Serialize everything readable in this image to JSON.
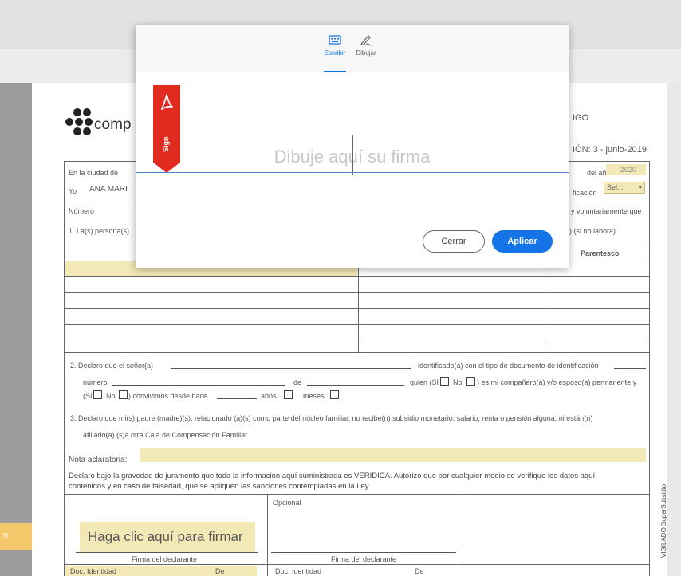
{
  "sign_tab": {
    "label": "rr"
  },
  "document": {
    "logo_text": "comp",
    "code_text": "IGO",
    "version_text": "IÓN: 3 - junio-2019",
    "line1": {
      "label": "En la ciudad de",
      "year_label": "del año",
      "year_value": "2020"
    },
    "line2": {
      "label": "Yo",
      "name_value": "ANA MARI",
      "ident_label": "ficación",
      "select_value": "Sel..."
    },
    "line3": {
      "label": "Número",
      "suffix": "y voluntariamente que"
    },
    "line4": {
      "label": "1.  La(s) persona(s)",
      "suffix": ") (si no labora)"
    },
    "table": {
      "col_parentesco": "Parentesco"
    },
    "sec2": {
      "a": "2.   Declaro que el señor(a)",
      "b": "identificado(a) con el tipo de documento de identificación",
      "c": "número",
      "d": "de",
      "e": "quien (SI",
      "f": "No",
      "g": ") es mi compañero(a) y/o esposo(a) permanente y",
      "h": "(SI",
      "i": "No",
      "j": ") convivimos desde hace",
      "k": "años",
      "l": "meses"
    },
    "sec3": {
      "a": "3.   Declaro que mi(s) padre (madre)(s), relacionado (a)(s) como parte del núcleo familiar, no recibe(n) subsidio monetario, salario, renta o pensión alguna, ni están(n)",
      "b": "afiliado(a) (s)a otra Caja de Compensación Familiar."
    },
    "nota_label": "Nota aclaratoria:",
    "declaro_1": "Declaro bajo la gravedad de juramento que toda la información aquí suministrada es VERÍDICA.  Autorizo que por cualquier medio se verifique los datos aquí",
    "declaro_2": "contenidos y en caso de falsedad, que se apliquen las sanciones contempladas en la Ley.",
    "opcional": "Opcional",
    "firmar_btn": "Haga clic aquí para firmar",
    "firma_declarante_1": "Firma del declarante",
    "firma_declarante_2": "Firma del declarante",
    "doc_id_1": "Doc. Identidad",
    "de_1": "De",
    "doc_id_2": "Doc. Identidad",
    "de_2": "De",
    "side_text": "VIGILADO SuperSubsidio"
  },
  "modal": {
    "tab_escribir": "Escribir",
    "tab_dibujar": "Dibujar",
    "ribbon_text": "Sign",
    "placeholder": "Dibuje aquí su firma",
    "cerrar": "Cerrar",
    "aplicar": "Aplicar"
  },
  "colors": {
    "accent": "#1473e6",
    "ribbon": "#e22b20",
    "field": "#f3e9b6"
  }
}
